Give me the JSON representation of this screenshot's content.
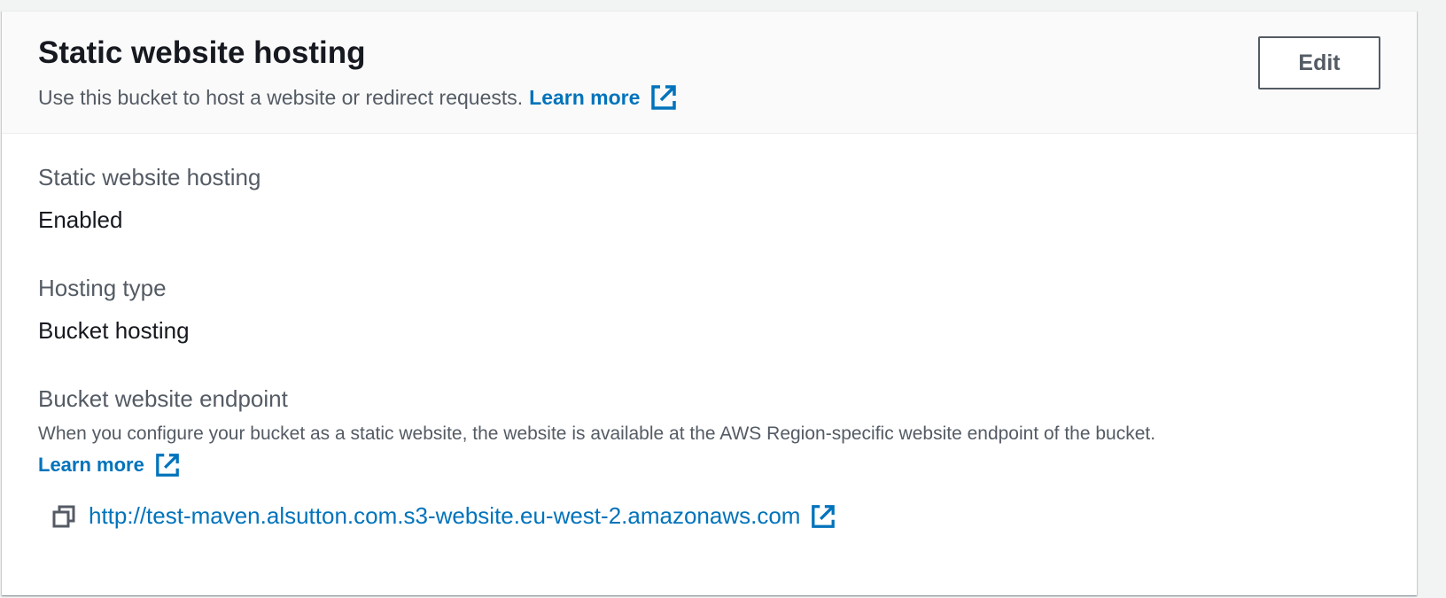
{
  "header": {
    "title": "Static website hosting",
    "description": "Use this bucket to host a website or redirect requests.",
    "learn_more": "Learn more",
    "edit_label": "Edit"
  },
  "fields": {
    "hosting": {
      "label": "Static website hosting",
      "value": "Enabled"
    },
    "hosting_type": {
      "label": "Hosting type",
      "value": "Bucket hosting"
    },
    "endpoint": {
      "label": "Bucket website endpoint",
      "description": "When you configure your bucket as a static website, the website is available at the AWS Region-specific website endpoint of the bucket.",
      "learn_more": "Learn more",
      "url": "http://test-maven.alsutton.com.s3-website.eu-west-2.amazonaws.com"
    }
  },
  "icons": {
    "external_link": "external-link-icon",
    "copy": "copy-icon"
  },
  "colors": {
    "link": "#0073bb",
    "header_bg": "#fafafa",
    "secondary_text": "#545b64"
  }
}
